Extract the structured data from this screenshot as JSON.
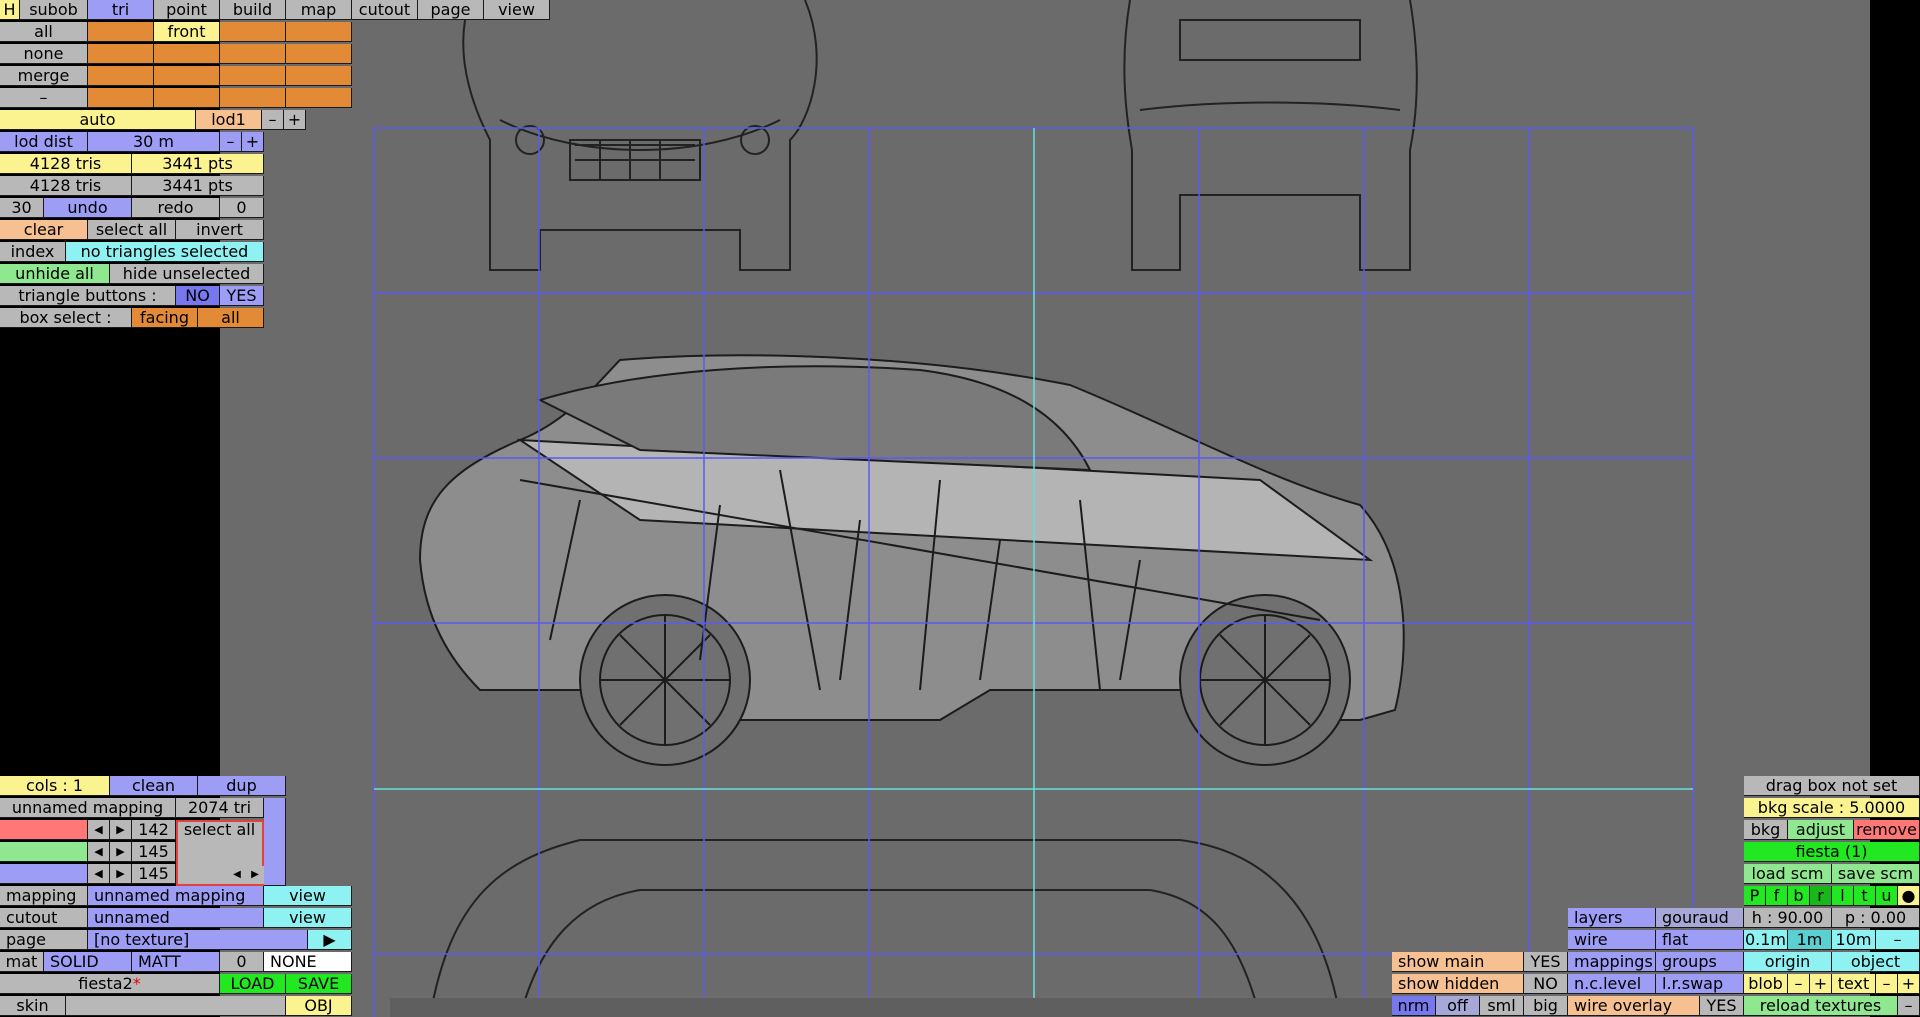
{
  "colors": {
    "viewport": "#6b6b6b",
    "grid": "#5a5af0",
    "grid_center": "#66e0e0"
  },
  "top_tabs": [
    "H",
    "subob",
    "tri",
    "point",
    "build",
    "map",
    "cutout",
    "page",
    "view"
  ],
  "select": {
    "all": "all",
    "none": "none",
    "merge": "merge",
    "dash": "–",
    "front": "front"
  },
  "lod": {
    "auto": "auto",
    "lod": "lod1",
    "minus": "–",
    "plus": "+",
    "dist_label": "lod dist",
    "dist_value": "30 m"
  },
  "stats": {
    "tris1": "4128 tris",
    "pts1": "3441 pts",
    "tris2": "4128 tris",
    "pts2": "3441 pts"
  },
  "undo": {
    "count": "30",
    "undo": "undo",
    "redo": "redo",
    "redo_count": "0"
  },
  "sel_buttons": {
    "clear": "clear",
    "select_all": "select all",
    "invert": "invert",
    "index": "index",
    "status": "no triangles selected",
    "unhide_all": "unhide all",
    "hide_unselected": "hide unselected",
    "tri_buttons": "triangle buttons :",
    "no": "NO",
    "yes": "YES",
    "box_select": "box select :",
    "facing": "facing",
    "box_all": "all"
  },
  "mapping_panel": {
    "cols": "cols : 1",
    "clean": "clean",
    "dup": "dup",
    "mapping_name": "unnamed mapping",
    "tri_count": "2074 tri",
    "r": "142",
    "g": "145",
    "b": "145",
    "select_all": "select all",
    "left": "◀",
    "right": "▶",
    "mapping_label": "mapping",
    "mapping_value": "unnamed mapping",
    "view": "view",
    "cutout_label": "cutout",
    "cutout_value": "unnamed",
    "page_label": "page",
    "page_value": "[no texture]",
    "play": "▶",
    "mat": "mat",
    "solid": "SOLID",
    "matt": "MATT",
    "zero": "0",
    "none": "NONE",
    "file": "fiesta2",
    "star": "*",
    "load": "LOAD",
    "save": "SAVE",
    "skin": "skin",
    "obj": "OBJ"
  },
  "right_panel": {
    "drag_box": "drag box not set",
    "bkg_scale": "bkg scale : 5.0000",
    "bkg": "bkg",
    "adjust": "adjust",
    "remove": "remove",
    "model": "fiesta (1)",
    "load_scm": "load scm",
    "save_scm": "save scm",
    "views": [
      "P",
      "f",
      "b",
      "r",
      "l",
      "t",
      "u",
      "●"
    ],
    "h": "h : 90.00",
    "p": "p : 0.00",
    "s1": "0.1m",
    "s2": "1m",
    "s3": "10m",
    "minus": "–",
    "origin": "origin",
    "object": "object",
    "blob": "blob",
    "text": "text",
    "plus": "+",
    "reload": "reload textures"
  },
  "display": {
    "layers": "layers",
    "gouraud": "gouraud",
    "wire": "wire",
    "flat": "flat",
    "mappings": "mappings",
    "groups": "groups",
    "nclevel": "n.c.level",
    "lrswap": "l.r.swap",
    "wire_overlay": "wire overlay",
    "yes": "YES"
  },
  "show": {
    "main": "show main",
    "main_val": "YES",
    "hidden": "show hidden",
    "hidden_val": "NO",
    "nrm": "nrm",
    "off": "off",
    "sml": "sml",
    "big": "big"
  }
}
